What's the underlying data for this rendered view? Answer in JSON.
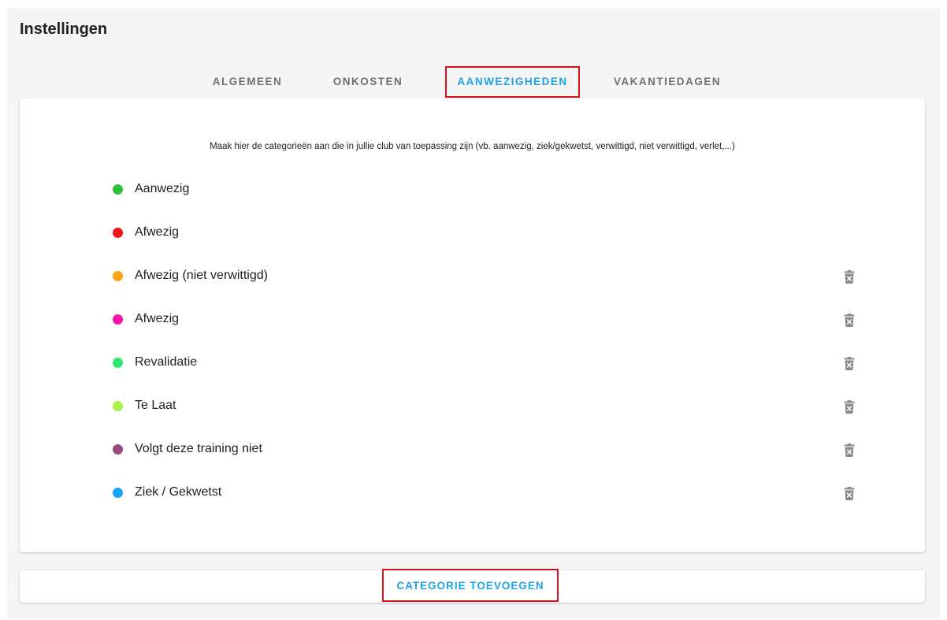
{
  "page": {
    "title": "Instellingen"
  },
  "tabs": [
    {
      "label": "ALGEMEEN",
      "active": false
    },
    {
      "label": "ONKOSTEN",
      "active": false
    },
    {
      "label": "AANWEZIGHEDEN",
      "active": true
    },
    {
      "label": "VAKANTIEDAGEN",
      "active": false
    }
  ],
  "intro": "Maak hier de categorieën aan die in jullie club van toepassing zijn (vb. aanwezig, ziek/gekwetst, verwittigd, niet verwittigd, verlet,...)",
  "categories": [
    {
      "label": "Aanwezig",
      "color": "#2dbe3c",
      "deletable": false
    },
    {
      "label": "Afwezig",
      "color": "#f01414",
      "deletable": false
    },
    {
      "label": "Afwezig (niet verwittigd)",
      "color": "#fba315",
      "deletable": true
    },
    {
      "label": "Afwezig",
      "color": "#f516a9",
      "deletable": true
    },
    {
      "label": "Revalidatie",
      "color": "#2fe670",
      "deletable": true
    },
    {
      "label": "Te Laat",
      "color": "#a8f04a",
      "deletable": true
    },
    {
      "label": "Volgt deze training niet",
      "color": "#9b4a7d",
      "deletable": true
    },
    {
      "label": "Ziek / Gekwetst",
      "color": "#17a5f5",
      "deletable": true
    }
  ],
  "icons": {
    "delete": "trash-icon"
  },
  "actions": {
    "add_category": "CATEGORIE TOEVOEGEN"
  },
  "colors": {
    "accent": "#1ea3e8",
    "highlight": "#e0101a"
  }
}
